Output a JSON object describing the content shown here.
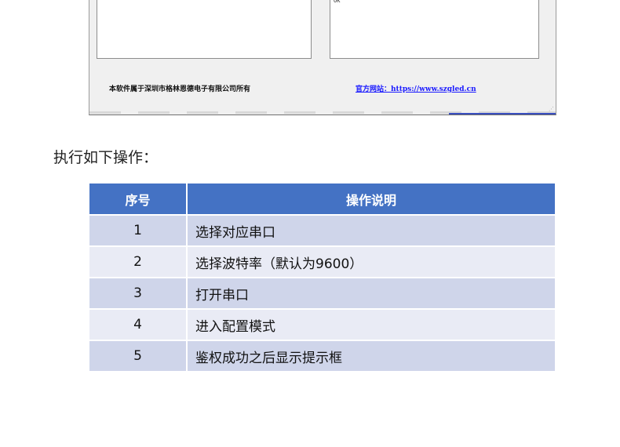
{
  "screenshot": {
    "output_text": "OK",
    "copyright": "本软件属于深圳市格林恩德电子有限公司所有",
    "website": "官方网站：https://www.szgled.cn"
  },
  "intro": "执行如下操作：",
  "table": {
    "headers": [
      "序号",
      "操作说明"
    ],
    "rows": [
      {
        "no": "1",
        "desc": "选择对应串口"
      },
      {
        "no": "2",
        "desc": "选择波特率（默认为9600）"
      },
      {
        "no": "3",
        "desc": "打开串口"
      },
      {
        "no": "4",
        "desc": "进入配置模式"
      },
      {
        "no": "5",
        "desc": "鉴权成功之后显示提示框"
      }
    ]
  },
  "colors": {
    "header_bg": "#4472c4",
    "row_odd": "#cfd5ea",
    "row_even": "#e9ebf5",
    "link": "#1a1aff"
  }
}
